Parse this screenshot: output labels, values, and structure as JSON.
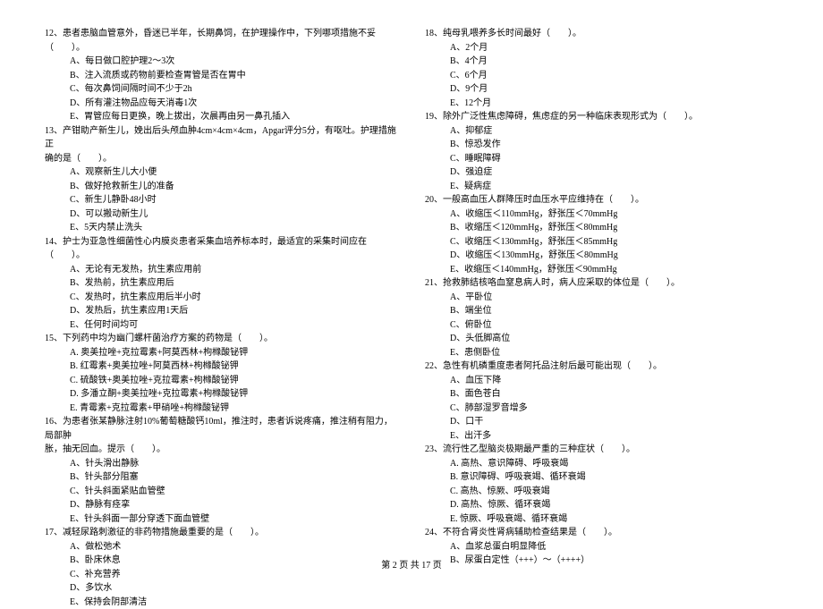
{
  "footer": "第 2 页 共 17 页",
  "left": {
    "q12": {
      "stem": "12、患者患脑血管意外，昏迷已半年，长期鼻饲，在护理操作中，下列哪项措施不妥（　　）。",
      "opts": [
        "A、每日做口腔护理2～3次",
        "B、注入流质或药物前要检查胃管是否在胃中",
        "C、每次鼻饲间隔时间不少于2h",
        "D、所有灌注物品应每天消毒1次",
        "E、胃管应每日更换，晚上拔出，次晨再由另一鼻孔插入"
      ]
    },
    "q13": {
      "stem": "13、产钳助产新生儿，娩出后头颅血肿4cm×4cm×4cm，Apgar评分5分，有呕吐。护理措施正",
      "stem2": "确的是（　　）。",
      "opts": [
        "A、观察新生儿大小便",
        "B、做好抢救新生儿的准备",
        "C、新生儿静卧48小时",
        "D、可以搬动新生儿",
        "E、5天内禁止洗头"
      ]
    },
    "q14": {
      "stem": "14、护士为亚急性细菌性心内膜炎患者采集血培养标本时，最适宜的采集时间应在（　　）。",
      "opts": [
        "A、无论有无发热，抗生素应用前",
        "B、发热前，抗生素应用后",
        "C、发热时，抗生素应用后半小时",
        "D、发热后，抗生素应用1天后",
        "E、任何时间均可"
      ]
    },
    "q15": {
      "stem": "15、下列药中均为幽门螺杆菌治疗方案的药物是（　　）。",
      "opts": [
        "A. 奥美拉唑+克拉霉素+阿莫西林+枸橼酸铋钾",
        "B. 红霉素+奥美拉唑+阿莫西林+枸橼酸铋钾",
        "C. 硫酸铁+奥美拉唑+克拉霉素+枸橼酸铋钾",
        "D. 多潘立酮+奥美拉唑+克拉霉素+枸橼酸铋钾",
        "E. 青霉素+克拉霉素+甲硝唑+枸橼酸铋钾"
      ]
    },
    "q16": {
      "stem": "16、为患者张某静脉注射10%葡萄糖酸钙10ml，推注时，患者诉说疼痛，推注稍有阻力，局部肿",
      "stem2": "胀，抽无回血。提示（　　）。",
      "opts": [
        "A、针头滑出静脉",
        "B、针头部分阻塞",
        "C、针头斜面紧贴血管壁",
        "D、静脉有痉挛",
        "E、针头斜面一部分穿透下面血管壁"
      ]
    },
    "q17": {
      "stem": "17、减轻尿路刺激征的非药物措施最重要的是（　　）。",
      "opts": [
        "A、做松弛术",
        "B、卧床休息",
        "C、补充营养",
        "D、多饮水",
        "E、保持会阴部清洁"
      ]
    }
  },
  "right": {
    "q18": {
      "stem": "18、纯母乳喂养多长时间最好（　　）。",
      "opts": [
        "A、2个月",
        "B、4个月",
        "C、6个月",
        "D、9个月",
        "E、12个月"
      ]
    },
    "q19": {
      "stem": "19、除外广泛性焦虑障碍，焦虑症的另一种临床表现形式为（　　）。",
      "opts": [
        "A、抑郁症",
        "B、惊恐发作",
        "C、睡眠障碍",
        "D、强迫症",
        "E、疑病症"
      ]
    },
    "q20": {
      "stem": "20、一般高血压人群降压时血压水平应维持在（　　）。",
      "opts": [
        "A、收缩压＜110mmHg，舒张压＜70mmHg",
        "B、收缩压＜120mmHg，舒张压＜80mmHg",
        "C、收缩压＜130mmHg，舒张压＜85mmHg",
        "D、收缩压＜130mmHg，舒张压＜80mmHg",
        "E、收缩压＜140mmHg，舒张压＜90mmHg"
      ]
    },
    "q21": {
      "stem": "21、抢救肺结核咯血窒息病人时，病人应采取的体位是（　　）。",
      "opts": [
        "A、平卧位",
        "B、端坐位",
        "C、俯卧位",
        "D、头低脚高位",
        "E、患侧卧位"
      ]
    },
    "q22": {
      "stem": "22、急性有机磷重度患者阿托品注射后最可能出现（　　）。",
      "opts": [
        "A、血压下降",
        "B、面色苍白",
        "C、肺部湿罗音增多",
        "D、口干",
        "E、出汗多"
      ]
    },
    "q23": {
      "stem": "23、流行性乙型脑炎极期最严重的三种症状（　　）。",
      "opts": [
        "A. 高热、意识障碍、呼吸衰竭",
        "B. 意识障碍、呼吸衰竭、循环衰竭",
        "C. 高热、惊厥、呼吸衰竭",
        "D. 高热、惊厥、循环衰竭",
        "E. 惊厥、呼吸衰竭、循环衰竭"
      ]
    },
    "q24": {
      "stem": "24、不符合肾炎性肾病辅助检查结果是（　　）。",
      "opts": [
        "A、血浆总蛋白明显降低",
        "B、尿蛋白定性（+++）～（++++）"
      ]
    }
  }
}
